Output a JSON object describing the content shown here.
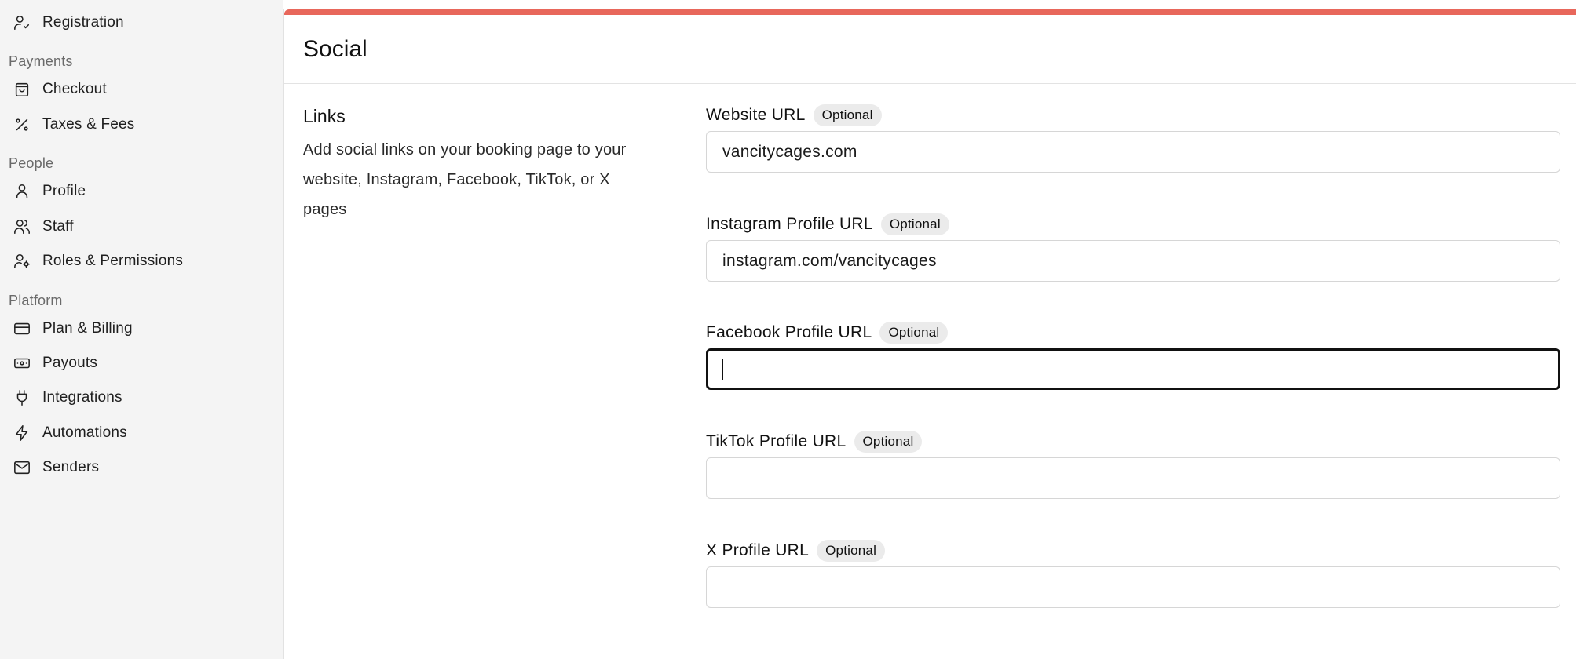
{
  "sidebar": {
    "items": [
      {
        "label": "Registration",
        "icon": "user-check-icon"
      },
      {
        "label": "Checkout",
        "icon": "shopping-bag-icon"
      },
      {
        "label": "Taxes & Fees",
        "icon": "percent-icon"
      },
      {
        "label": "Profile",
        "icon": "user-icon"
      },
      {
        "label": "Staff",
        "icon": "users-icon"
      },
      {
        "label": "Roles & Permissions",
        "icon": "user-cog-icon"
      },
      {
        "label": "Plan & Billing",
        "icon": "credit-card-icon"
      },
      {
        "label": "Payouts",
        "icon": "banknote-icon"
      },
      {
        "label": "Integrations",
        "icon": "plug-icon"
      },
      {
        "label": "Automations",
        "icon": "zap-icon"
      },
      {
        "label": "Senders",
        "icon": "mail-icon"
      }
    ],
    "sections": {
      "payments": "Payments",
      "people": "People",
      "platform": "Platform"
    }
  },
  "page": {
    "title": "Social",
    "accent_color": "#e8675b"
  },
  "links_section": {
    "title": "Links",
    "description": "Add social links on your booking page to your website, Instagram, Facebook, TikTok, or X pages"
  },
  "fields": [
    {
      "label": "Website URL",
      "badge": "Optional",
      "value": "vancitycages.com"
    },
    {
      "label": "Instagram Profile URL",
      "badge": "Optional",
      "value": "instagram.com/vancitycages"
    },
    {
      "label": "Facebook Profile URL",
      "badge": "Optional",
      "value": ""
    },
    {
      "label": "TikTok Profile URL",
      "badge": "Optional",
      "value": ""
    },
    {
      "label": "X Profile URL",
      "badge": "Optional",
      "value": ""
    }
  ]
}
